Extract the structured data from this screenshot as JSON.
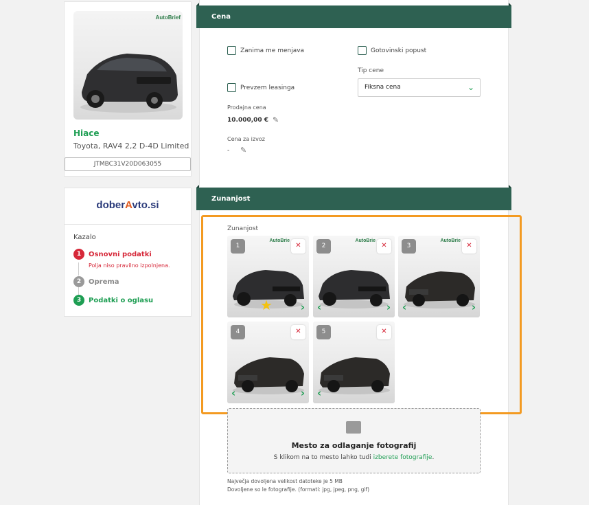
{
  "vehicle": {
    "watermark": "AutoBrief",
    "name": "Hiace",
    "model": "Toyota, RAV4 2,2 D-4D Limited",
    "vin": "JTMBC31V20D063055"
  },
  "brand": {
    "logo_part1": "dober",
    "logo_accent": "A",
    "logo_part2": "vto.si"
  },
  "toc": {
    "title": "Kazalo",
    "steps": [
      {
        "num": "1",
        "label": "Osnovni podatki",
        "status": "error",
        "color": "#d62839"
      },
      {
        "num": "2",
        "label": "Oprema",
        "status": "neutral",
        "color": "#9a9a9a"
      },
      {
        "num": "3",
        "label": "Podatki o oglasu",
        "status": "done",
        "color": "#1e9e53"
      }
    ],
    "error_text": "Polja niso pravilno izpolnjena."
  },
  "price_section": {
    "header": "Cena",
    "checkbox_trade": "Zanima me menjava",
    "checkbox_cash": "Gotovinski popust",
    "checkbox_leasing": "Prevzem leasinga",
    "price_type_label": "Tip cene",
    "price_type_value": "Fiksna cena",
    "sale_price_label": "Prodajna cena",
    "sale_price_value": "10.000,00 €",
    "export_price_label": "Cena za izvoz",
    "export_price_value": "-"
  },
  "exterior_section": {
    "header": "Zunanjost",
    "gallery_label": "Zunanjost",
    "photos": [
      {
        "num": "1",
        "watermark": "AutoBrie",
        "featured": true
      },
      {
        "num": "2",
        "watermark": "AutoBrie",
        "featured": false
      },
      {
        "num": "3",
        "watermark": "AutoBrie",
        "featured": false
      },
      {
        "num": "4",
        "watermark": "",
        "featured": false
      },
      {
        "num": "5",
        "watermark": "",
        "featured": false
      }
    ],
    "dropzone_title": "Mesto za odlaganje fotografij",
    "dropzone_text": "S klikom na to mesto lahko tudi",
    "dropzone_link": "izberete fotografije",
    "dropzone_text_end": ".",
    "note_size": "Največja dovoljena velikost datoteke je 5 MB",
    "note_formats": "Dovoljene so le fotografije. (formati: jpg, jpeg, png, gif)"
  },
  "colors": {
    "header_green": "#2e6152",
    "accent_green": "#1e9e53",
    "error_red": "#d62839",
    "highlight_orange": "#f39a21"
  }
}
